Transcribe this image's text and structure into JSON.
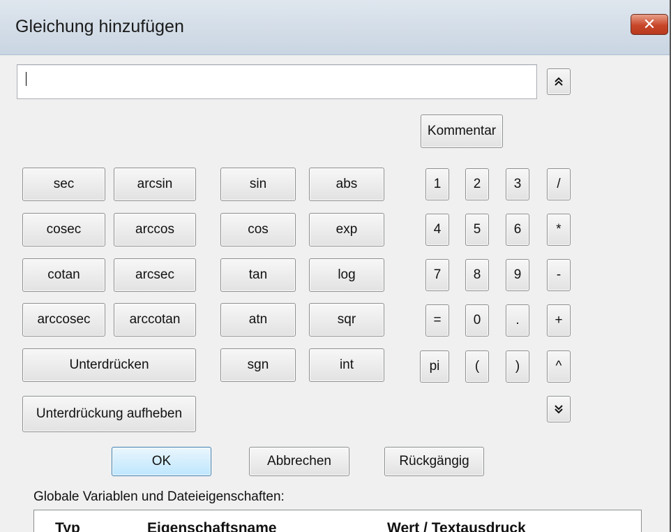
{
  "window": {
    "title": "Gleichung hinzufügen",
    "close_label": "✕"
  },
  "equation_input": {
    "value": ""
  },
  "toolbar": {
    "collapse_up_label": "⌃",
    "comment_label": "Kommentar",
    "expand_down_label": "⌄"
  },
  "functions": {
    "sec": "sec",
    "arcsin": "arcsin",
    "sin": "sin",
    "abs": "abs",
    "cosec": "cosec",
    "arccos": "arccos",
    "cos": "cos",
    "exp": "exp",
    "cotan": "cotan",
    "arcsec": "arcsec",
    "tan": "tan",
    "log": "log",
    "arccosec": "arccosec",
    "arccotan": "arccotan",
    "atn": "atn",
    "sqr": "sqr",
    "sgn": "sgn",
    "int": "int"
  },
  "keypad": {
    "k1": "1",
    "k2": "2",
    "k3": "3",
    "div": "/",
    "k4": "4",
    "k5": "5",
    "k6": "6",
    "mul": "*",
    "k7": "7",
    "k8": "8",
    "k9": "9",
    "sub": "-",
    "eq": "=",
    "k0": "0",
    "dot": ".",
    "add": "+",
    "pi": "pi",
    "lparen": "(",
    "rparen": ")",
    "pow": "^"
  },
  "actions": {
    "suppress": "Unterdrücken",
    "unsuppress": "Unterdrückung aufheben",
    "ok": "OK",
    "cancel": "Abbrechen",
    "undo": "Rückgängig"
  },
  "variables": {
    "heading": "Globale Variablen und Dateieigenschaften:",
    "columns": [
      "Typ",
      "Eigenschaftsname",
      "Wert / Textausdruck"
    ]
  }
}
